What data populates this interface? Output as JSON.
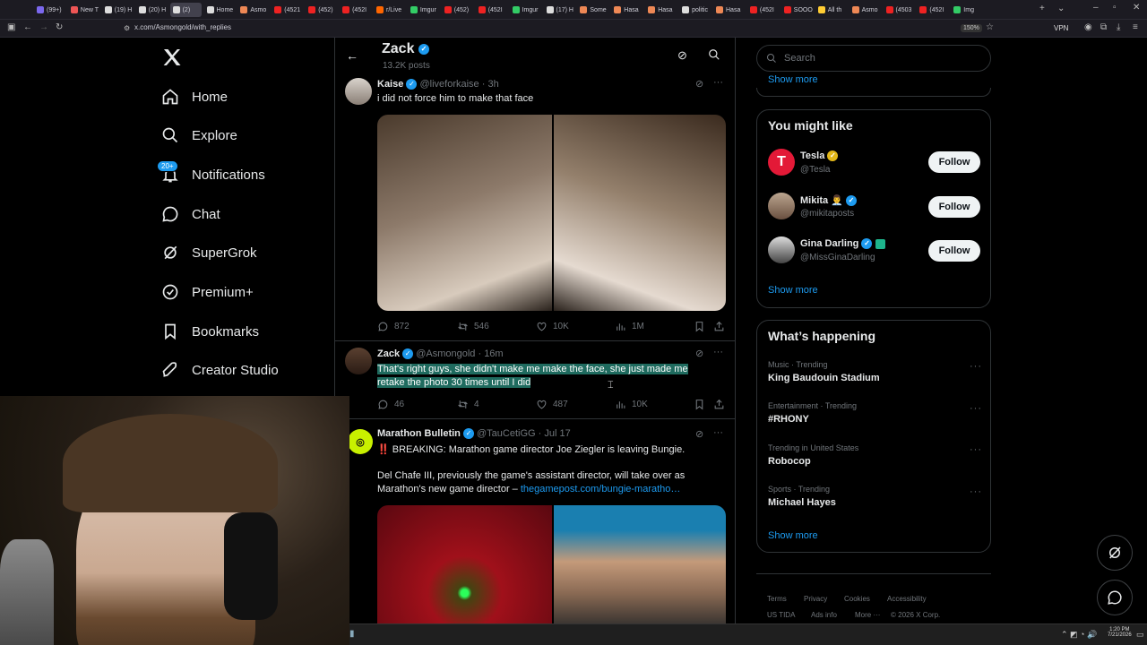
{
  "browser": {
    "tabs": [
      {
        "label": "(99+)",
        "color": "#7b68ee"
      },
      {
        "label": "New T",
        "color": "#e55"
      },
      {
        "label": "(19) H",
        "color": "#ddd"
      },
      {
        "label": "(20) H",
        "color": "#ddd"
      },
      {
        "label": "(2)",
        "color": "#ddd",
        "active": true
      },
      {
        "label": "Home",
        "color": "#ddd"
      },
      {
        "label": "Asmo",
        "color": "#e85"
      },
      {
        "label": "(4521",
        "color": "#e22"
      },
      {
        "label": "(452)",
        "color": "#e22"
      },
      {
        "label": "(452I",
        "color": "#e22"
      },
      {
        "label": "r/Live",
        "color": "#f60"
      },
      {
        "label": "Imgur",
        "color": "#3c6"
      },
      {
        "label": "(452)",
        "color": "#e22"
      },
      {
        "label": "(452I",
        "color": "#e22"
      },
      {
        "label": "Imgur",
        "color": "#3c6"
      },
      {
        "label": "(17) H",
        "color": "#ddd"
      },
      {
        "label": "Some",
        "color": "#e85"
      },
      {
        "label": "Hasa",
        "color": "#e85"
      },
      {
        "label": "Hasa",
        "color": "#e85"
      },
      {
        "label": "politic",
        "color": "#ddd"
      },
      {
        "label": "Hasa",
        "color": "#e85"
      },
      {
        "label": "(452I",
        "color": "#e22"
      },
      {
        "label": "SOOO",
        "color": "#e22"
      },
      {
        "label": "All th",
        "color": "#fc3"
      },
      {
        "label": "Asmo",
        "color": "#e85"
      },
      {
        "label": "(4503",
        "color": "#e22"
      },
      {
        "label": "(452I",
        "color": "#e22"
      },
      {
        "label": "Img",
        "color": "#3c6"
      }
    ],
    "url": "x.com/Asmongold/with_replies",
    "zoom": "150%",
    "vpn": "VPN"
  },
  "nav": {
    "items": [
      {
        "label": "Home",
        "icon": "home-icon"
      },
      {
        "label": "Explore",
        "icon": "search-icon"
      },
      {
        "label": "Notifications",
        "icon": "bell-icon"
      },
      {
        "label": "Chat",
        "icon": "chat-icon"
      },
      {
        "label": "SuperGrok",
        "icon": "grok-icon"
      },
      {
        "label": "Premium+",
        "icon": "premium-icon"
      },
      {
        "label": "Bookmarks",
        "icon": "bookmark-icon"
      },
      {
        "label": "Creator Studio",
        "icon": "rocket-icon"
      }
    ],
    "notif_badge": "20+"
  },
  "profile_header": {
    "name": "Zack",
    "posts": "13.2K posts"
  },
  "tweets": {
    "kaise": {
      "name": "Kaise",
      "handle": "@liveforkaise",
      "time": "· 3h",
      "text": "i did not force him to make that face",
      "replies": "872",
      "retweets": "546",
      "likes": "10K",
      "views": "1M"
    },
    "zack": {
      "name": "Zack",
      "handle": "@Asmongold",
      "time": "· 16m",
      "text": "That's right guys, she didn't make me make the face, she just made me retake the photo 30 times until I did",
      "replies": "46",
      "retweets": "4",
      "likes": "487",
      "views": "10K"
    },
    "marathon": {
      "name": "Marathon Bulletin",
      "handle": "@TauCetiGG",
      "time": "· Jul 17",
      "line1": "‼️ BREAKING: Marathon game director Joe Ziegler is leaving Bungie.",
      "line2": "Del Chafe III, previously the game's assistant director, will take over as",
      "line3_prefix": "Marathon's new game director –",
      "link": "thegamepost.com/bungie-maratho…"
    }
  },
  "sidebar": {
    "search_placeholder": "Search",
    "top_show_more": "Show more",
    "might_like": {
      "title": "You might like",
      "accounts": [
        {
          "name": "Tesla",
          "handle": "@Tesla",
          "button": "Follow"
        },
        {
          "name": "Mikita 👨‍💼",
          "handle": "@mikitaposts",
          "button": "Follow"
        },
        {
          "name": "Gina Darling",
          "handle": "@MissGinaDarling",
          "button": "Follow"
        }
      ],
      "show_more": "Show more"
    },
    "happening": {
      "title": "What’s happening",
      "trends": [
        {
          "category": "Music · Trending",
          "name": "King Baudouin Stadium"
        },
        {
          "category": "Entertainment · Trending",
          "name": "#RHONY"
        },
        {
          "category": "Trending in United States",
          "name": "Robocop"
        },
        {
          "category": "Sports · Trending",
          "name": "Michael Hayes"
        }
      ],
      "show_more": "Show more"
    },
    "footer": {
      "row1": [
        "Terms",
        "Privacy",
        "Cookies",
        "Accessibility"
      ],
      "row2": [
        "US TIDA",
        "Ads info",
        "More ···",
        "© 2026 X Corp."
      ]
    }
  },
  "taskbar": {
    "time": "1:20 PM",
    "date": "7/21/2026"
  },
  "colors": {
    "accent": "#1d9bf0",
    "bg": "#000000",
    "border": "#2f3336",
    "highlight": "#1f6b5f"
  }
}
